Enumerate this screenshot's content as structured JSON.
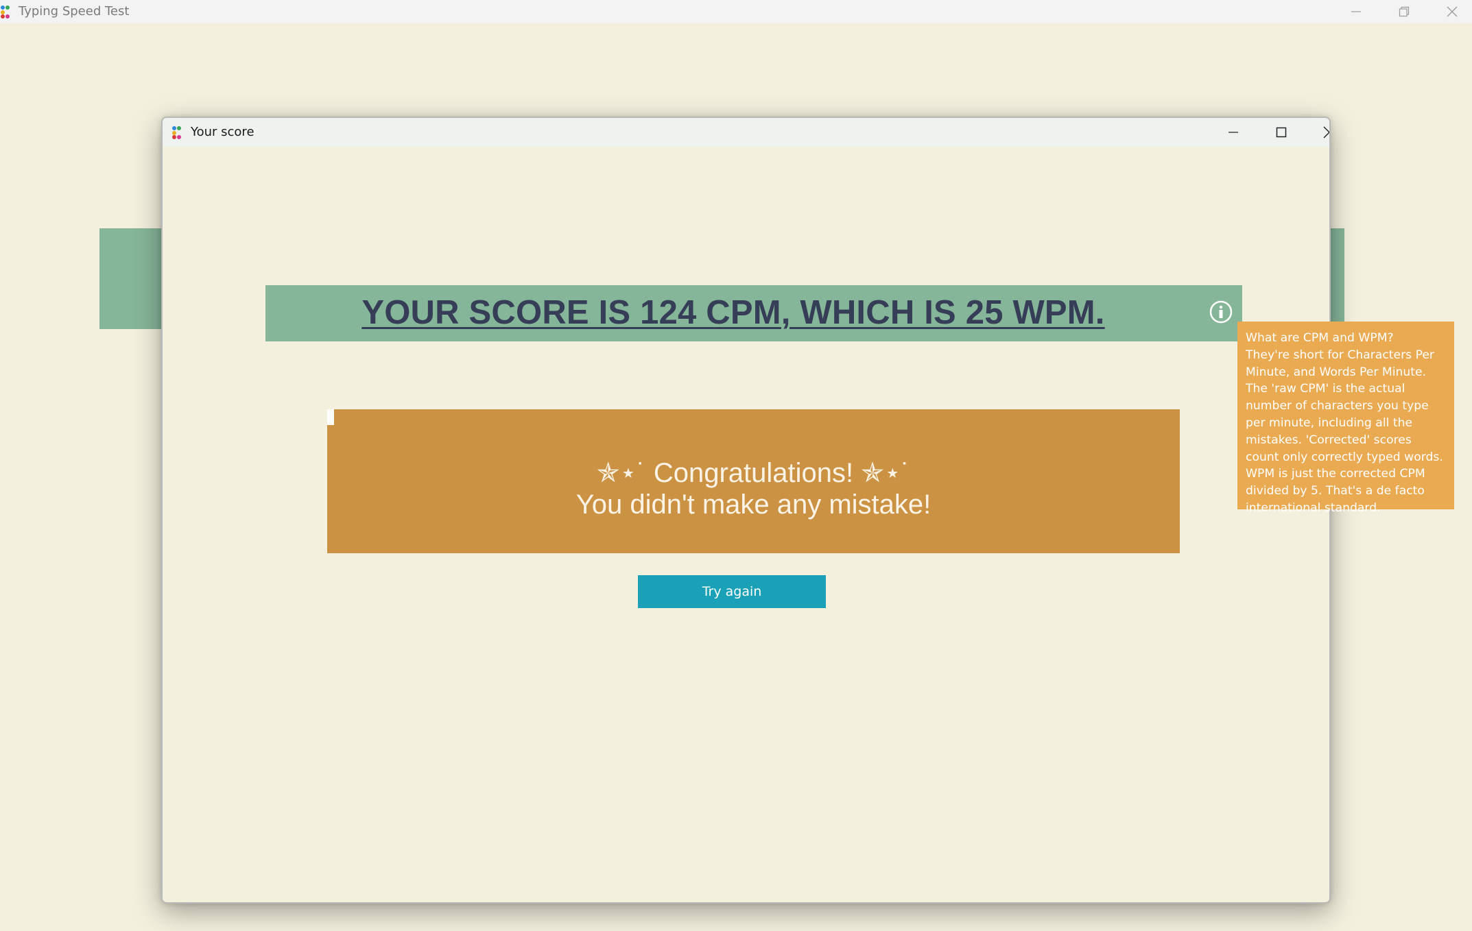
{
  "app": {
    "title": "Typing Speed Test",
    "icon": "app-logo-icon"
  },
  "window_controls": {
    "minimize_icon": "minimize-icon",
    "restore_icon": "restore-icon",
    "close_icon": "close-icon"
  },
  "dialog": {
    "title": "Your score",
    "controls": {
      "minimize_icon": "minimize-icon",
      "maximize_icon": "maximize-icon",
      "close_icon": "close-icon"
    },
    "score_text": "YOUR SCORE IS 124 CPM, WHICH IS 25 WPM.",
    "info_icon": "info-icon",
    "congrats_line1": "✯⋆˙ Congratulations! ✯⋆˙",
    "congrats_line2": "You didn't make any mistake!",
    "try_again_label": "Try again"
  },
  "tooltip": {
    "title": "What are CPM and WPM?",
    "body": "They're short for Characters Per Minute, and Words Per Minute. The 'raw CPM' is the actual number of characters you type per minute, including all the mistakes. 'Corrected' scores count only correctly typed words. WPM is just the corrected CPM divided by 5. That's a de facto international standard."
  },
  "colors": {
    "background": "#f4f0de",
    "banner_green": "#86b69a",
    "score_text": "#363d57",
    "congrats_orange": "#cc9244",
    "button_teal": "#1aa1b8",
    "tooltip_orange": "#eaaa52"
  }
}
